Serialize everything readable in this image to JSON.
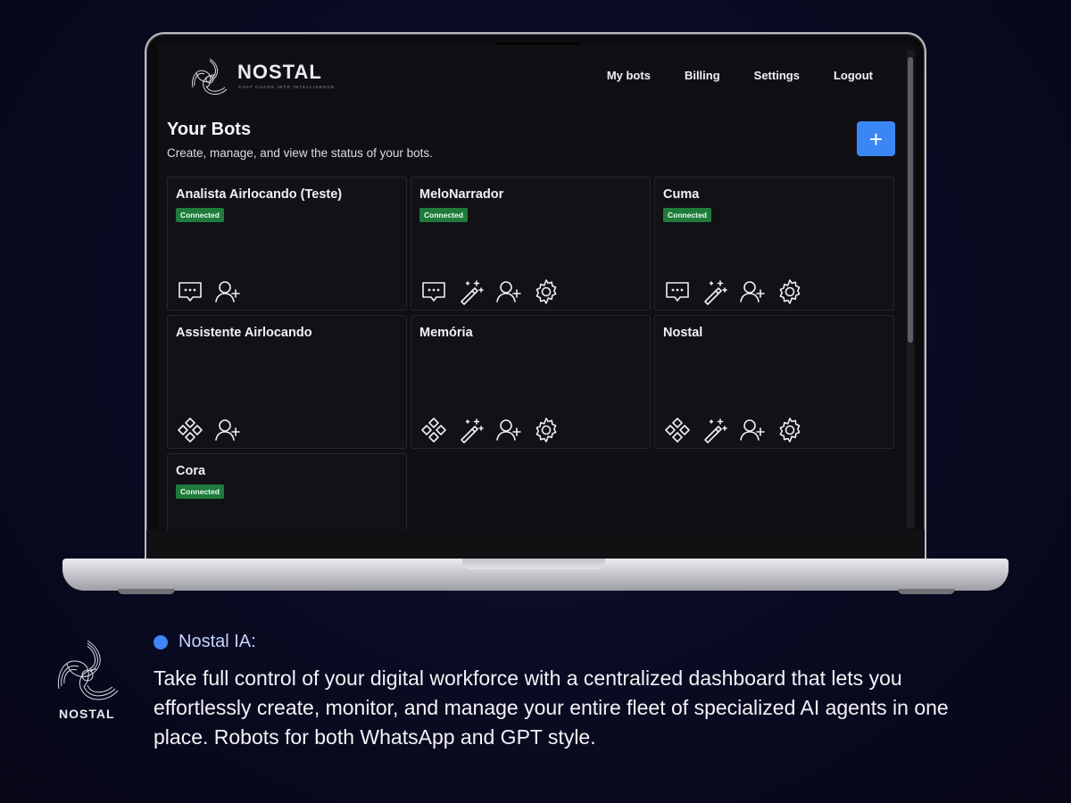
{
  "app": {
    "brand": {
      "name": "NOSTAL",
      "tagline": "CHAT CHAOS INTO INTELLIGENCE"
    },
    "nav": [
      "My bots",
      "Billing",
      "Settings",
      "Logout"
    ],
    "page": {
      "title": "Your Bots",
      "subtitle": "Create, manage, and view the status of your bots.",
      "add_button": "+"
    },
    "bots": [
      {
        "name": "Analista Airlocando (Teste)",
        "status": "Connected",
        "icons": [
          "chat-icon",
          "add-user-icon"
        ]
      },
      {
        "name": "MeloNarrador",
        "status": "Connected",
        "icons": [
          "chat-icon",
          "magic-wand-icon",
          "add-user-icon",
          "gear-icon"
        ]
      },
      {
        "name": "Cuma",
        "status": "Connected",
        "icons": [
          "chat-icon",
          "magic-wand-icon",
          "add-user-icon",
          "gear-icon"
        ]
      },
      {
        "name": "Assistente Airlocando",
        "status": "",
        "icons": [
          "diamond-grid-icon",
          "add-user-icon"
        ]
      },
      {
        "name": "Memória",
        "status": "",
        "icons": [
          "diamond-grid-icon",
          "magic-wand-icon",
          "add-user-icon",
          "gear-icon"
        ]
      },
      {
        "name": "Nostal",
        "status": "",
        "icons": [
          "diamond-grid-icon",
          "magic-wand-icon",
          "add-user-icon",
          "gear-icon"
        ]
      },
      {
        "name": "Cora",
        "status": "Connected",
        "icons": []
      }
    ]
  },
  "caption": {
    "logo_text": "NOSTAL",
    "label": "Nostal IA:",
    "body": "Take full control of your digital workforce with a centralized dashboard that lets you effortlessly create, monitor, and manage your entire fleet of specialized AI agents in one place. Robots for both WhatsApp and GPT style."
  },
  "colors": {
    "accent": "#3a86f5",
    "connected": "#1f7a3b",
    "dot": "#3f86f7"
  }
}
